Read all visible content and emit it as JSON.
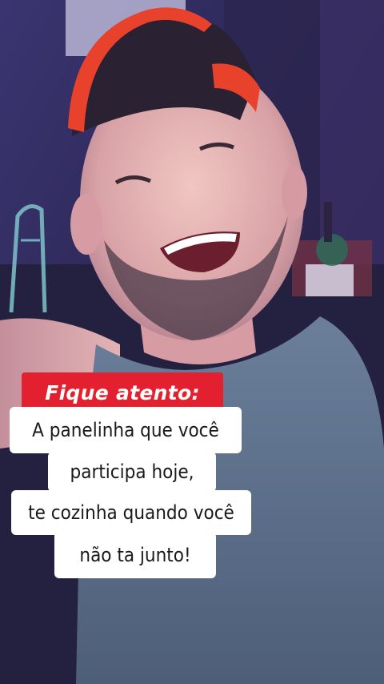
{
  "caption": {
    "headline": "Fique atento:",
    "lines": [
      "A panelinha que você",
      "participa hoje,",
      "te cozinha quando você",
      "não ta junto!"
    ]
  },
  "colors": {
    "headline_bg": "#e3202f",
    "caption_bg": "#ffffff",
    "cap_red": "#e8412c",
    "shirt": "#5b6f8a"
  }
}
